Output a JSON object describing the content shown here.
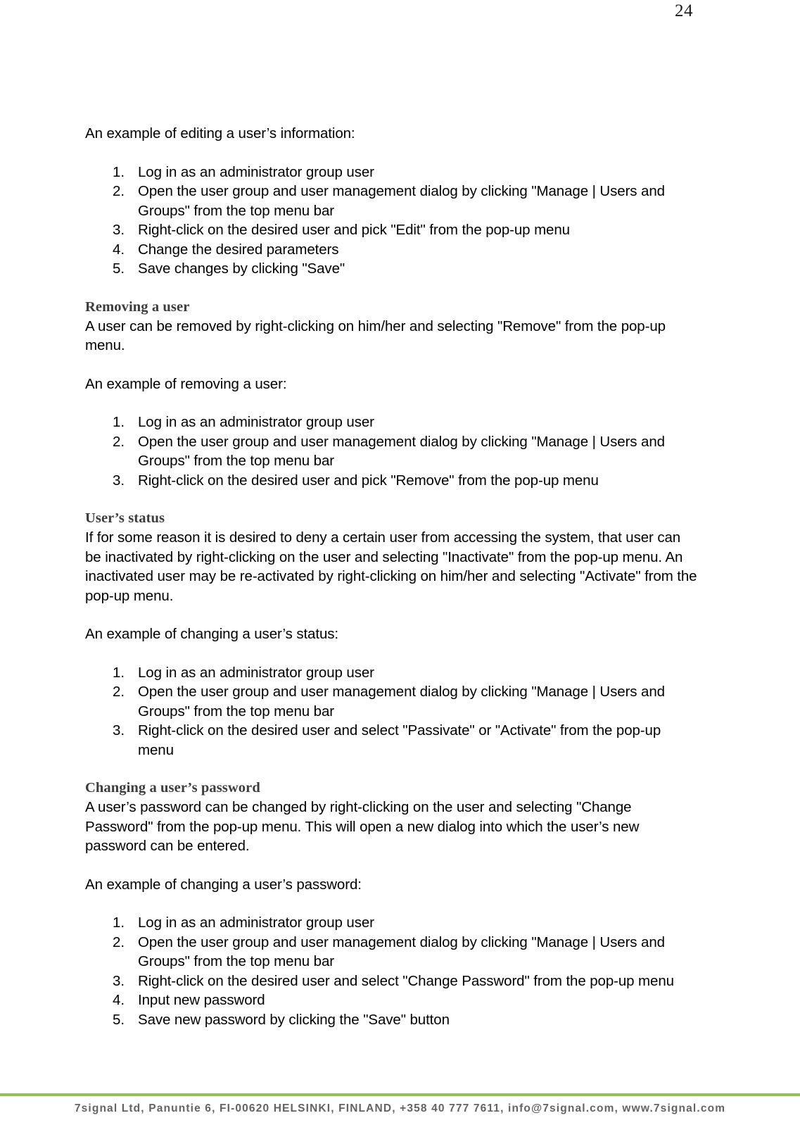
{
  "document": {
    "page_number": "24",
    "footer_text": "7signal Ltd, Panuntie 6, FI-00620 HELSINKI, FINLAND, +358 40 777 7611, info@7signal.com, www.7signal.com",
    "accent_color": "#93c153",
    "heading_color": "#3d3d3d",
    "footer_text_color": "#636363"
  },
  "sections": {
    "editing_example": {
      "intro": "An example of editing a user’s information:",
      "steps": [
        "Log in as an administrator group user",
        "Open the user group and user management dialog by clicking \"Manage | Users and Groups\" from the top menu bar",
        "Right-click on the desired user and pick \"Edit\" from the pop-up menu",
        "Change the desired parameters",
        "Save changes by clicking \"Save\""
      ]
    },
    "removing_a_user": {
      "heading": "Removing a user",
      "body": "A user can be removed by right-clicking on him/her and selecting \"Remove\" from the pop-up menu.",
      "intro": "An example of removing a user:",
      "steps": [
        "Log in as an administrator group user",
        "Open the user group and user management dialog by clicking \"Manage | Users and Groups\" from the top menu bar",
        "Right-click on the desired user and pick \"Remove\" from the pop-up menu"
      ]
    },
    "users_status": {
      "heading": "User’s status",
      "body": "If for some reason it is desired to deny a certain user from accessing the system, that user can be inactivated by right-clicking on the user and selecting \"Inactivate\" from the pop-up menu. An inactivated user may be re-activated by right-clicking on him/her and selecting \"Activate\" from the pop-up menu.",
      "intro": "An example of changing a user’s status:",
      "steps": [
        "Log in as an administrator group user",
        "Open the user group and user management dialog by clicking \"Manage | Users and Groups\" from the top menu bar",
        "Right-click on the desired user and select \"Passivate\" or \"Activate\" from the pop-up menu"
      ]
    },
    "changing_password": {
      "heading": "Changing a user’s password",
      "body": "A user’s password can be changed by right-clicking on the user and selecting \"Change Password\" from the pop-up menu. This will open a new dialog into which the user’s new password can be entered.",
      "intro": "An example of changing a user’s password:",
      "steps": [
        "Log in as an administrator group user",
        "Open the user group and user management dialog by clicking \"Manage | Users and Groups\" from the top menu bar",
        "Right-click on the desired user and select \"Change Password\" from the pop-up menu",
        "Input new password",
        "Save new password by clicking the \"Save\" button"
      ]
    }
  }
}
